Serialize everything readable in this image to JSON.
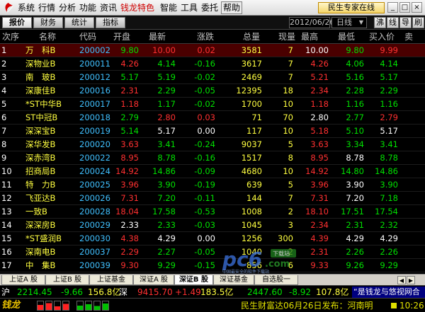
{
  "menubar": {
    "items": [
      "系统",
      "行情",
      "分析",
      "功能",
      "资讯",
      "钱龙特色",
      "智能",
      "工具",
      "委托",
      "帮助"
    ],
    "expert_button": "民生专家在线",
    "window_controls": [
      "_",
      "□",
      "×"
    ]
  },
  "tabbar": {
    "tabs": [
      "报价",
      "财务",
      "统计",
      "指标"
    ],
    "date": "2012/06/26",
    "period": "日线",
    "right_tools": [
      "沸",
      "线",
      "导",
      "刷"
    ]
  },
  "table": {
    "headers": [
      "次序",
      "名称",
      "代码",
      "开盘",
      "最新",
      "涨跌",
      "总量",
      "现量",
      "最高",
      "最低",
      "买入价",
      "卖"
    ],
    "rows": [
      {
        "no": "1",
        "name": "万　科B",
        "code": "200002",
        "open": "9.80",
        "last": "10.00",
        "chg": "0.02",
        "vol": "3581",
        "cur": "7",
        "high": "10.00",
        "low": "9.80",
        "bid": "9.99"
      },
      {
        "no": "2",
        "name": "深物业B",
        "code": "200011",
        "open": "4.26",
        "last": "4.14",
        "chg": "-0.16",
        "vol": "3617",
        "cur": "7",
        "high": "4.26",
        "low": "4.06",
        "bid": "4.14"
      },
      {
        "no": "3",
        "name": "南　玻B",
        "code": "200012",
        "open": "5.17",
        "last": "5.19",
        "chg": "-0.02",
        "vol": "2469",
        "cur": "7",
        "high": "5.21",
        "low": "5.16",
        "bid": "5.17"
      },
      {
        "no": "4",
        "name": "深康佳B",
        "code": "200016",
        "open": "2.31",
        "last": "2.29",
        "chg": "-0.05",
        "vol": "12395",
        "cur": "18",
        "high": "2.34",
        "low": "2.28",
        "bid": "2.29"
      },
      {
        "no": "5",
        "name": "*ST中华B",
        "code": "200017",
        "open": "1.18",
        "last": "1.17",
        "chg": "-0.02",
        "vol": "1700",
        "cur": "10",
        "high": "1.18",
        "low": "1.16",
        "bid": "1.16"
      },
      {
        "no": "6",
        "name": "ST中冠B",
        "code": "200018",
        "open": "2.79",
        "last": "2.80",
        "chg": "0.03",
        "vol": "71",
        "cur": "70",
        "high": "2.80",
        "low": "2.77",
        "bid": "2.79"
      },
      {
        "no": "7",
        "name": "深深宝B",
        "code": "200019",
        "open": "5.14",
        "last": "5.17",
        "chg": "0.00",
        "vol": "117",
        "cur": "10",
        "high": "5.18",
        "low": "5.10",
        "bid": "5.17"
      },
      {
        "no": "8",
        "name": "深华发B",
        "code": "200020",
        "open": "3.63",
        "last": "3.41",
        "chg": "-0.24",
        "vol": "9037",
        "cur": "5",
        "high": "3.63",
        "low": "3.34",
        "bid": "3.41"
      },
      {
        "no": "9",
        "name": "深赤湾B",
        "code": "200022",
        "open": "8.95",
        "last": "8.78",
        "chg": "-0.16",
        "vol": "1517",
        "cur": "8",
        "high": "8.95",
        "low": "8.78",
        "bid": "8.78"
      },
      {
        "no": "10",
        "name": "招商局B",
        "code": "200024",
        "open": "14.92",
        "last": "14.86",
        "chg": "-0.09",
        "vol": "4680",
        "cur": "10",
        "high": "14.92",
        "low": "14.80",
        "bid": "14.86"
      },
      {
        "no": "11",
        "name": "特　力B",
        "code": "200025",
        "open": "3.96",
        "last": "3.90",
        "chg": "-0.19",
        "vol": "639",
        "cur": "5",
        "high": "3.96",
        "low": "3.90",
        "bid": "3.90"
      },
      {
        "no": "12",
        "name": "飞亚达B",
        "code": "200026",
        "open": "7.31",
        "last": "7.20",
        "chg": "-0.11",
        "vol": "144",
        "cur": "7",
        "high": "7.31",
        "low": "7.20",
        "bid": "7.18"
      },
      {
        "no": "13",
        "name": "一致B",
        "code": "200028",
        "open": "18.04",
        "last": "17.58",
        "chg": "-0.53",
        "vol": "1008",
        "cur": "2",
        "high": "18.10",
        "low": "17.51",
        "bid": "17.54"
      },
      {
        "no": "14",
        "name": "深深房B",
        "code": "200029",
        "open": "2.33",
        "last": "2.33",
        "chg": "-0.03",
        "vol": "1045",
        "cur": "3",
        "high": "2.34",
        "low": "2.31",
        "bid": "2.32"
      },
      {
        "no": "15",
        "name": "*ST盛润B",
        "code": "200030",
        "open": "4.38",
        "last": "4.29",
        "chg": "0.00",
        "vol": "1256",
        "cur": "300",
        "high": "4.39",
        "low": "4.29",
        "bid": "4.29"
      },
      {
        "no": "16",
        "name": "深南电B",
        "code": "200037",
        "open": "2.29",
        "last": "2.27",
        "chg": "-0.05",
        "vol": "1040",
        "cur": "2",
        "high": "2.31",
        "low": "2.26",
        "bid": "2.26"
      },
      {
        "no": "17",
        "name": "中　集B",
        "code": "200039",
        "open": "9.30",
        "last": "9.29",
        "chg": "-0.15",
        "vol": "856",
        "cur": "6",
        "high": "9.33",
        "low": "9.26",
        "bid": "9.29"
      },
      {
        "no": "18",
        "name": "深纺织B",
        "code": "200045",
        "open": "3.81",
        "last": "3.73",
        "chg": "-0.05",
        "vol": "113",
        "cur": "5",
        "high": "3.81",
        "low": "3.73",
        "bid": "3.73"
      }
    ]
  },
  "market_tabs": [
    "上证A 股",
    "上证B 股",
    "上证基金",
    "深证A 股",
    "深证B 股",
    "深证基金",
    "自选股一"
  ],
  "index_bar": {
    "sh_label": "沪",
    "sh_value": "2214.45",
    "sh_change": "-9.66",
    "sh_amount": "156.8亿",
    "sz_label": "深",
    "sz_value": "9415.70",
    "sz_change": "+1.49",
    "sz_amount": "183.5亿",
    "third_value": "2447.60",
    "third_change": "-8.92",
    "third_amount": "107.8亿",
    "news": "“是钱龙与悠视网合"
  },
  "status_bar": {
    "brand": "钱龙",
    "message": "民生财富达06月26日发布：河南明",
    "time": "10:26"
  },
  "watermark": {
    "main": "pc6",
    "suffix": ".com",
    "badge": "下载站",
    "tagline": "中国最安全的软件下载站"
  },
  "colors": {
    "up": "#ff3030",
    "down": "#00e000",
    "neutral": "#ffffff",
    "code": "#40c0ff",
    "name": "#ffff40",
    "volume": "#ffff40",
    "row_number": "#ffffff",
    "selected_bg": "#4a0000"
  }
}
